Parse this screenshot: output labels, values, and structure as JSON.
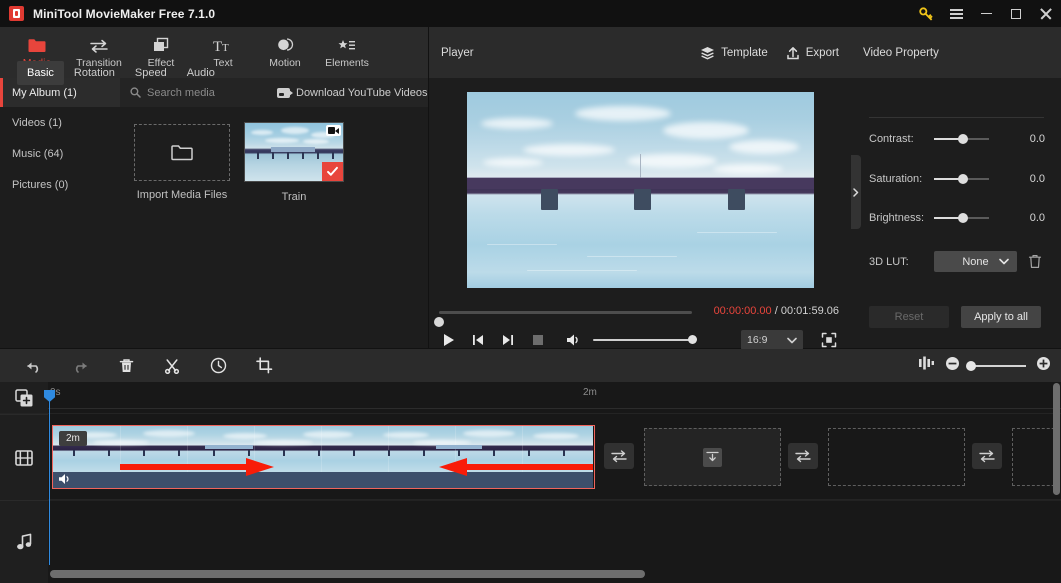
{
  "window": {
    "title": "MiniTool MovieMaker Free 7.1.0",
    "logo_icon": "app-logo-icon",
    "controls": {
      "key_icon": "key-icon",
      "menu_icon": "hamburger-menu-icon",
      "minimize_icon": "minimize-icon",
      "maximize_icon": "maximize-icon",
      "close_icon": "close-icon"
    }
  },
  "ribbon": {
    "items": [
      {
        "label": "Media",
        "icon": "folder-icon",
        "active": true
      },
      {
        "label": "Transition",
        "icon": "transition-arrows-icon",
        "active": false
      },
      {
        "label": "Effect",
        "icon": "effect-squares-icon",
        "active": false
      },
      {
        "label": "Text",
        "icon": "text-tt-icon",
        "active": false
      },
      {
        "label": "Motion",
        "icon": "motion-circle-icon",
        "active": false
      },
      {
        "label": "Elements",
        "icon": "elements-star-list-icon",
        "active": false
      }
    ]
  },
  "media_panel": {
    "album_tab": "My Album (1)",
    "search": {
      "placeholder": "Search media",
      "icon": "search-icon"
    },
    "download_youtube": {
      "label": "Download YouTube Videos",
      "icon": "youtube-camera-icon"
    },
    "albums": [
      {
        "label": "Videos (1)"
      },
      {
        "label": "Music (64)"
      },
      {
        "label": "Pictures (0)"
      }
    ],
    "import_tile": {
      "label": "Import Media Files",
      "icon": "folder-open-icon"
    },
    "items": [
      {
        "label": "Train",
        "type": "video",
        "selected": true,
        "badge_icon": "video-badge-icon",
        "check_icon": "check-icon"
      }
    ]
  },
  "player": {
    "title": "Player",
    "actions": [
      {
        "label": "Template",
        "icon": "layers-icon"
      },
      {
        "label": "Export",
        "icon": "export-upload-icon"
      }
    ],
    "time": {
      "current": "00:00:00.00",
      "separator": "/",
      "total": "00:01:59.06"
    },
    "controls": [
      {
        "name": "play-button",
        "icon": "play-icon"
      },
      {
        "name": "prev-frame-button",
        "icon": "previous-frame-icon"
      },
      {
        "name": "next-frame-button",
        "icon": "next-frame-icon"
      },
      {
        "name": "stop-button",
        "icon": "stop-icon"
      },
      {
        "name": "volume-button",
        "icon": "volume-icon"
      }
    ],
    "aspect_ratio": {
      "value": "16:9",
      "chevron_icon": "chevron-down-icon"
    },
    "fullscreen_icon": "fullscreen-icon",
    "progress_percent": 0,
    "volume_percent": 100
  },
  "video_property": {
    "title": "Video Property",
    "tabs": [
      {
        "label": "Basic",
        "active": true
      },
      {
        "label": "Rotation",
        "active": false
      },
      {
        "label": "Speed",
        "active": false
      },
      {
        "label": "Audio",
        "active": false
      }
    ],
    "sliders": [
      {
        "label": "Contrast:",
        "value": "0.0"
      },
      {
        "label": "Saturation:",
        "value": "0.0"
      },
      {
        "label": "Brightness:",
        "value": "0.0"
      }
    ],
    "lut": {
      "label": "3D LUT:",
      "value": "None",
      "chevron_icon": "chevron-down-icon",
      "delete_icon": "trash-icon"
    },
    "buttons": [
      {
        "label": "Reset",
        "disabled": true
      },
      {
        "label": "Apply to all",
        "disabled": false
      }
    ],
    "collapse_handle_icon": "chevron-right-icon"
  },
  "edit_toolbar": {
    "buttons": [
      {
        "name": "undo-button",
        "icon": "undo-arrow-icon"
      },
      {
        "name": "redo-button",
        "icon": "redo-arrow-icon"
      },
      {
        "name": "delete-button",
        "icon": "trash-icon"
      },
      {
        "name": "split-button",
        "icon": "scissors-icon"
      },
      {
        "name": "speed-button",
        "icon": "speedometer-icon"
      },
      {
        "name": "crop-button",
        "icon": "crop-icon"
      }
    ],
    "right": {
      "fit_icon": "fit-timeline-icon",
      "zoom_out_icon": "zoom-out-icon",
      "zoom_in_icon": "zoom-in-icon",
      "zoom_percent": 10
    }
  },
  "timeline": {
    "ruler": {
      "start_label": "0s",
      "end_label": "2m"
    },
    "track_heads": [
      {
        "name": "add-media-track-icon",
        "icon": "add-media-icon"
      },
      {
        "name": "video-track-icon",
        "icon": "film-strip-icon"
      },
      {
        "name": "audio-track-icon",
        "icon": "music-note-icon"
      }
    ],
    "clip": {
      "duration_badge": "2m",
      "audio_icon": "speaker-icon",
      "selected": true,
      "annotation_arrows": 2
    },
    "slots": [
      {
        "name": "slot-download",
        "icon": "download-slot-icon",
        "filled": false
      },
      {
        "name": "slot-empty-1",
        "icon": "",
        "filled": false
      },
      {
        "name": "slot-empty-2",
        "icon": "",
        "filled": false
      }
    ],
    "transition_buttons": [
      {
        "name": "transition-button-1",
        "icon": "transition-arrows-icon"
      },
      {
        "name": "transition-button-2",
        "icon": "transition-arrows-icon"
      },
      {
        "name": "transition-button-3",
        "icon": "transition-arrows-icon"
      }
    ]
  },
  "colors": {
    "accent_red": "#e8453c",
    "clip_border": "#f0645c",
    "playhead_blue": "#2f8ae0",
    "key_yellow": "#f0c419",
    "panel_bg": "#1d1d1d",
    "toolbar_bg": "#2b2b2b"
  }
}
